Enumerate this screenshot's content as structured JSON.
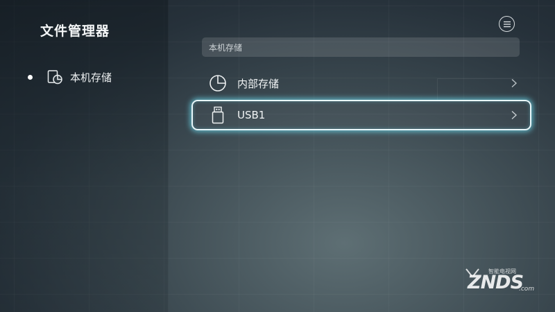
{
  "app": {
    "title": "文件管理器"
  },
  "sidebar": {
    "items": [
      {
        "label": "本机存储",
        "icon": "storage-chart-icon",
        "selected": true
      }
    ]
  },
  "header": {
    "menu_icon": "hamburger-menu-icon"
  },
  "location": {
    "path": "本机存储"
  },
  "storage_list": [
    {
      "label": "内部存储",
      "icon": "pie-chart-icon",
      "focused": false
    },
    {
      "label": "USB1",
      "icon": "usb-drive-icon",
      "focused": true
    }
  ],
  "watermark": {
    "sub": "智能电视网",
    "main": "ZNDS",
    "suffix": ".com"
  },
  "colors": {
    "focus_glow": "#6edcf0",
    "text": "#ffffff"
  }
}
